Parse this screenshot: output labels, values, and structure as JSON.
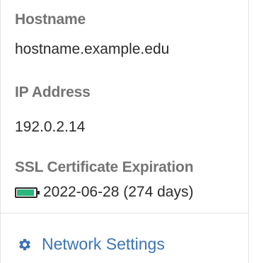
{
  "hostname": {
    "label": "Hostname",
    "value": "hostname.example.edu"
  },
  "ip_address": {
    "label": "IP Address",
    "value": "192.0.2.14"
  },
  "ssl": {
    "label": "SSL Certificate Expiration",
    "value": "2022-06-28 (274 days)",
    "status_icon": "battery-full-icon",
    "status_color": "#2db67c"
  },
  "footer": {
    "network_settings_label": "Network Settings",
    "icon": "gear-icon",
    "link_color": "#3c74b4"
  }
}
